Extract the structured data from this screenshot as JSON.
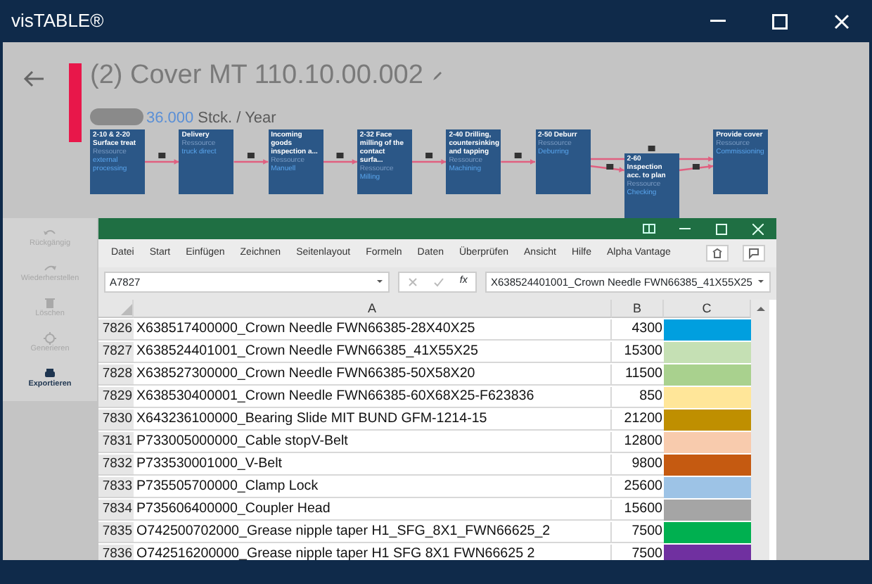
{
  "window": {
    "title": "visTABLE®"
  },
  "part": {
    "title": "(2) Cover MT 110.10.00.002",
    "quantity": "36.000",
    "unit": "Stck. / Year"
  },
  "process_steps": [
    {
      "title": "2-10 & 2-20 Surface treat",
      "resource_label": "Ressource",
      "resource": "external processing"
    },
    {
      "title": "Delivery",
      "resource_label": "Ressource",
      "resource": "truck direct"
    },
    {
      "title": "Incoming goods inspection a...",
      "resource_label": "Ressource",
      "resource": "Manuell"
    },
    {
      "title": "2-32 Face milling of the contact surfa...",
      "resource_label": "Ressource",
      "resource": "Milling"
    },
    {
      "title": "2-40 Drilling, countersinking and tapping",
      "resource_label": "Ressource",
      "resource": "Machining"
    },
    {
      "title": "2-50 Deburr",
      "resource_label": "Ressource",
      "resource": "Deburring",
      "children": [
        {
          "title": "2-60 Inspection acc. to plan",
          "resource_label": "Ressource",
          "resource": "Checking"
        }
      ]
    },
    {
      "title": "Provide cover",
      "resource_label": "Ressource",
      "resource": "Commissioning"
    }
  ],
  "sidebar": {
    "items": [
      {
        "kind": "undo",
        "label": "Rückgängig",
        "disabled": true
      },
      {
        "kind": "redo",
        "label": "Wiederherstellen",
        "disabled": true
      },
      {
        "kind": "delete",
        "label": "Löschen",
        "disabled": true
      },
      {
        "kind": "generate",
        "label": "Generieren",
        "disabled": true
      },
      {
        "kind": "export",
        "label": "Exportieren",
        "disabled": false
      }
    ]
  },
  "spreadsheet": {
    "menu": [
      "Datei",
      "Start",
      "Einfügen",
      "Zeichnen",
      "Seitenlayout",
      "Formeln",
      "Daten",
      "Überprüfen",
      "Ansicht",
      "Hilfe",
      "Alpha Vantage"
    ],
    "name_box": "A7827",
    "function_label": "fx",
    "formula": "X638524401001_Crown Needle FWN66385_41X55X25",
    "columns": [
      "A",
      "B",
      "C"
    ],
    "rows": [
      {
        "row_number": "7826",
        "a": "X638517400000_Crown Needle FWN66385-28X40X25",
        "b": "4300",
        "color": "#009fdf"
      },
      {
        "row_number": "7827",
        "a": "X638524401001_Crown Needle FWN66385_41X55X25",
        "b": "15300",
        "color": "#c5e0b4"
      },
      {
        "row_number": "7828",
        "a": "X638527300000_Crown Needle FWN66385-50X58X20",
        "b": "11500",
        "color": "#a9d18e"
      },
      {
        "row_number": "7829",
        "a": "X638530400001_Crown Needle FWN66385-60X68X25-F623836",
        "b": "850",
        "color": "#ffe699"
      },
      {
        "row_number": "7830",
        "a": "X643236100000_Bearing Slide MIT BUND GFM-1214-15",
        "b": "21200",
        "color": "#bf8f00"
      },
      {
        "row_number": "7831",
        "a": "P733005000000_Cable stopV-Belt",
        "b": "12800",
        "color": "#f8cbad"
      },
      {
        "row_number": "7832",
        "a": "P733530001000_V-Belt",
        "b": "9800",
        "color": "#c55a11"
      },
      {
        "row_number": "7833",
        "a": "P735505700000_Clamp Lock",
        "b": "25600",
        "color": "#9dc3e6"
      },
      {
        "row_number": "7834",
        "a": "P735606400000_Coupler Head",
        "b": "15600",
        "color": "#a5a5a5"
      },
      {
        "row_number": "7835",
        "a": "O742500702000_Grease nipple taper H1_SFG_8X1_FWN66625_2",
        "b": "7500",
        "color": "#00b050"
      },
      {
        "row_number": "7836",
        "a": "O742516200000_Grease nipple taper H1 SFG 8X1 FWN66625 2",
        "b": "7500",
        "color": "#7030a0"
      }
    ]
  }
}
